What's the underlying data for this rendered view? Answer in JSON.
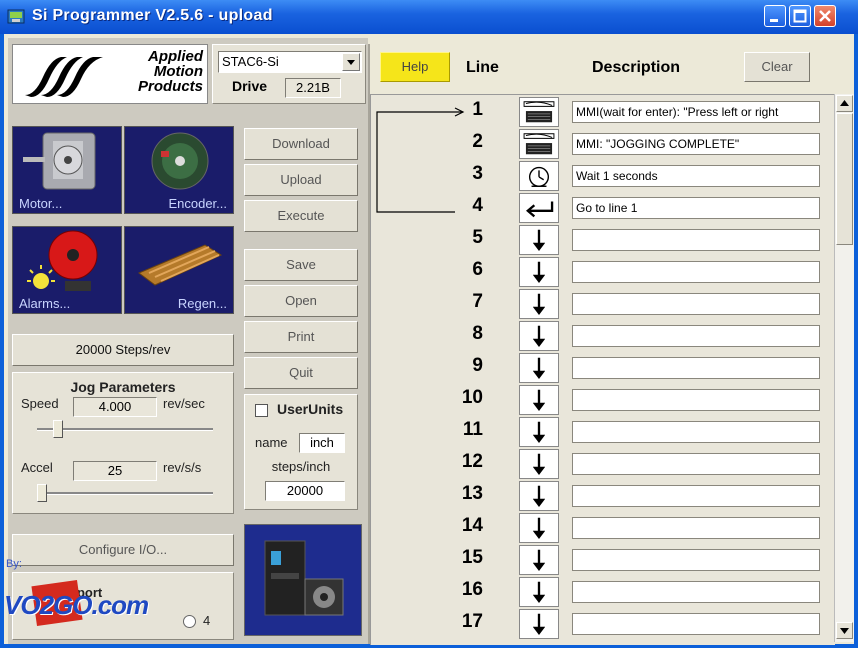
{
  "window": {
    "title": "Si Programmer  V2.5.6 - upload"
  },
  "logo": {
    "line1": "Applied",
    "line2": "Motion",
    "line3": "Products"
  },
  "drive": {
    "model": "STAC6-Si",
    "label": "Drive",
    "version": "2.21B"
  },
  "tiles": {
    "motor": "Motor...",
    "encoder": "Encoder...",
    "alarms": "Alarms...",
    "regen": "Regen..."
  },
  "steps_rev": "20000 Steps/rev",
  "jog": {
    "title": "Jog Parameters",
    "speed_label": "Speed",
    "speed_value": "4.000",
    "speed_unit": "rev/sec",
    "speed_level": 0.12,
    "accel_label": "Accel",
    "accel_value": "25",
    "accel_unit": "rev/s/s",
    "accel_level": 0.03
  },
  "actions": {
    "download": "Download",
    "upload": "Upload",
    "execute": "Execute",
    "save": "Save",
    "open": "Open",
    "print": "Print",
    "quit": "Quit"
  },
  "userunits": {
    "label": "UserUnits",
    "checked": false,
    "name_label": "name",
    "name_value": "inch",
    "steps_label": "steps/inch",
    "steps_value": "20000"
  },
  "configure_io": "Configure I/O...",
  "com_port": {
    "label": "COM port",
    "option4": "4"
  },
  "watermark": {
    "by": "By:",
    "brand": "VO2GO.com"
  },
  "program": {
    "help": "Help",
    "line_header": "Line",
    "desc_header": "Description",
    "clear": "Clear",
    "lines": [
      {
        "num": "1",
        "icon": "display-icon",
        "desc": "MMI(wait for enter): \"Press left or right"
      },
      {
        "num": "2",
        "icon": "display-icon",
        "desc": "MMI: \"JOGGING COMPLETE\""
      },
      {
        "num": "3",
        "icon": "clock-icon",
        "desc": "Wait 1 seconds"
      },
      {
        "num": "4",
        "icon": "goto-icon",
        "desc": "Go to line 1"
      },
      {
        "num": "5",
        "icon": "next-arrow-icon",
        "desc": ""
      },
      {
        "num": "6",
        "icon": "next-arrow-icon",
        "desc": ""
      },
      {
        "num": "7",
        "icon": "next-arrow-icon",
        "desc": ""
      },
      {
        "num": "8",
        "icon": "next-arrow-icon",
        "desc": ""
      },
      {
        "num": "9",
        "icon": "next-arrow-icon",
        "desc": ""
      },
      {
        "num": "10",
        "icon": "next-arrow-icon",
        "desc": ""
      },
      {
        "num": "11",
        "icon": "next-arrow-icon",
        "desc": ""
      },
      {
        "num": "12",
        "icon": "next-arrow-icon",
        "desc": ""
      },
      {
        "num": "13",
        "icon": "next-arrow-icon",
        "desc": ""
      },
      {
        "num": "14",
        "icon": "next-arrow-icon",
        "desc": ""
      },
      {
        "num": "15",
        "icon": "next-arrow-icon",
        "desc": ""
      },
      {
        "num": "16",
        "icon": "next-arrow-icon",
        "desc": ""
      },
      {
        "num": "17",
        "icon": "next-arrow-icon",
        "desc": ""
      }
    ]
  },
  "colors": {
    "titlebar": "#1a63e0",
    "help_button": "#f5e51a",
    "tile_bg": "#1a1c6a"
  }
}
